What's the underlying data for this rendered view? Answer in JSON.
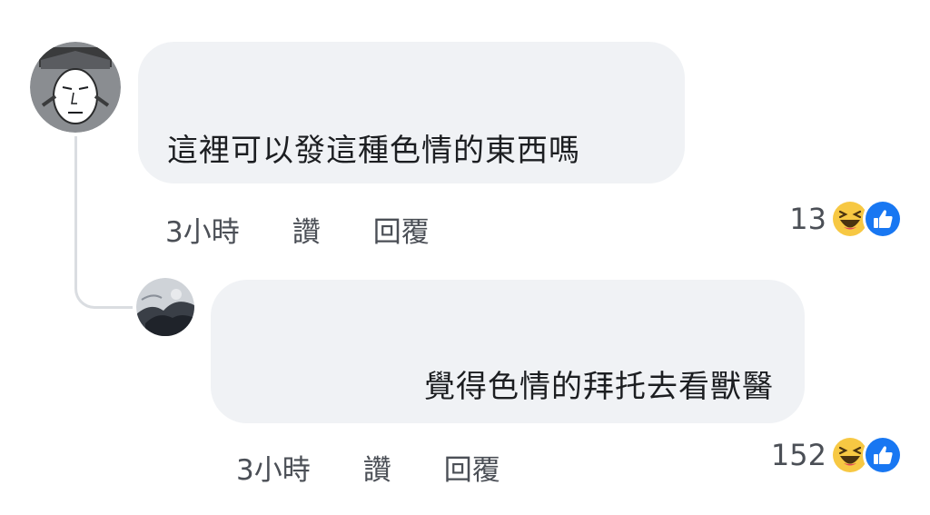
{
  "comments": [
    {
      "text": "這裡可以發這種色情的東西嗎",
      "time": "3小時",
      "like_label": "讚",
      "reply_label": "回覆",
      "reaction_count": "13",
      "reactions": [
        "haha-icon",
        "like-icon"
      ]
    },
    {
      "text": "覺得色情的拜托去看獸醫",
      "time": "3小時",
      "like_label": "讚",
      "reply_label": "回覆",
      "reaction_count": "152",
      "reactions": [
        "haha-icon",
        "like-icon"
      ]
    }
  ],
  "colors": {
    "bubble_background": "#f0f2f5",
    "meta_text": "#4b4f56",
    "like_blue": "#1877f2",
    "haha_yellow": "#f7c843",
    "thread_line": "#dadde1"
  }
}
